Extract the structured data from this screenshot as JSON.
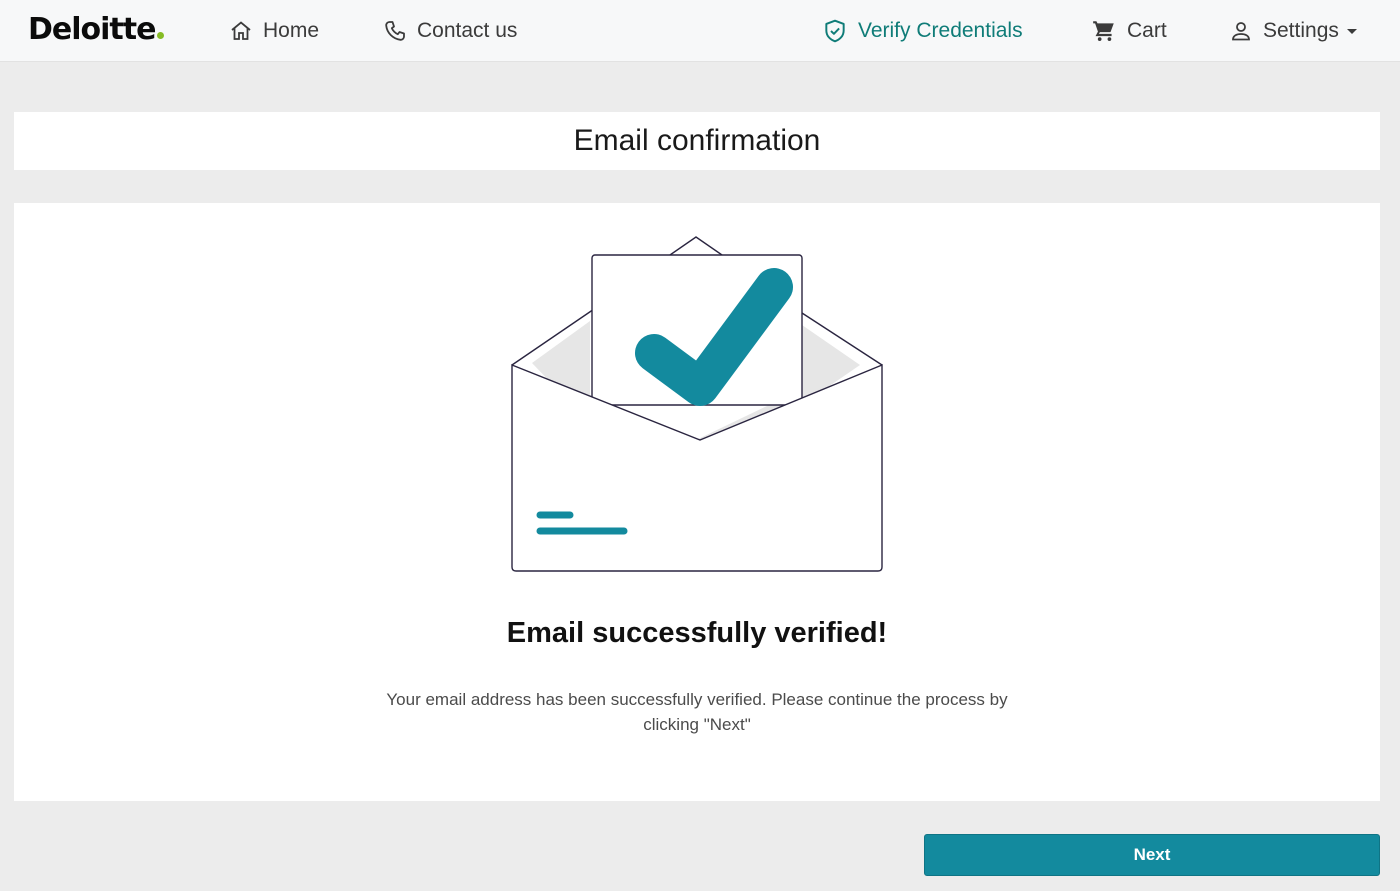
{
  "brand": {
    "name": "Deloitte",
    "accent_color": "#86bc25"
  },
  "nav": {
    "home": {
      "label": "Home",
      "icon": "home-icon"
    },
    "contact": {
      "label": "Contact us",
      "icon": "phone-icon"
    },
    "verify": {
      "label": "Verify Credentials",
      "icon": "shield-check-icon",
      "color": "#0f7c78"
    },
    "cart": {
      "label": "Cart",
      "icon": "cart-icon"
    },
    "settings": {
      "label": "Settings",
      "icon": "user-icon"
    }
  },
  "page": {
    "title": "Email confirmation",
    "headline": "Email successfully verified!",
    "description": "Your email address has been successfully verified. Please continue the process by clicking \"Next\""
  },
  "actions": {
    "next_label": "Next",
    "primary_color": "#138a9e"
  },
  "illustration": {
    "icon": "envelope-check-icon",
    "color": "#138a9e"
  }
}
